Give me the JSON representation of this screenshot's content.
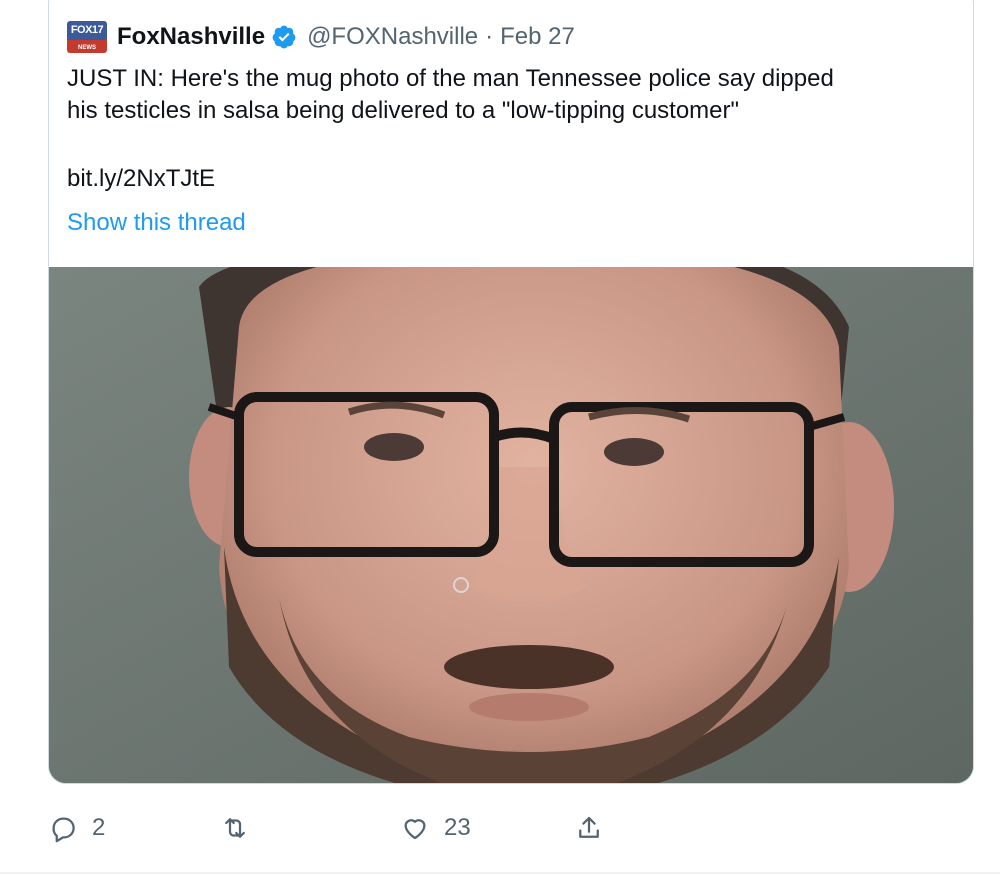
{
  "tweet": {
    "avatar_text": "FOX17",
    "avatar_sub": "NEWS",
    "display_name": "FoxNashville",
    "handle": "@FOXNashville",
    "separator": "·",
    "date": "Feb 27",
    "text": "JUST IN: Here's the mug photo of the man Tennessee police say dipped\nhis testicles in salsa being delivered to a \"low-tipping customer\"",
    "link": "bit.ly/2NxTJtE",
    "show_thread": "Show this thread"
  },
  "colors": {
    "accent": "#1d9bf0",
    "muted": "#536471",
    "text": "#0f1419",
    "border": "#cfd9de"
  },
  "actions": {
    "reply": {
      "icon": "reply-icon",
      "count": "2"
    },
    "retweet": {
      "icon": "retweet-icon",
      "count": ""
    },
    "like": {
      "icon": "heart-icon",
      "count": "23"
    },
    "share": {
      "icon": "share-icon"
    }
  }
}
